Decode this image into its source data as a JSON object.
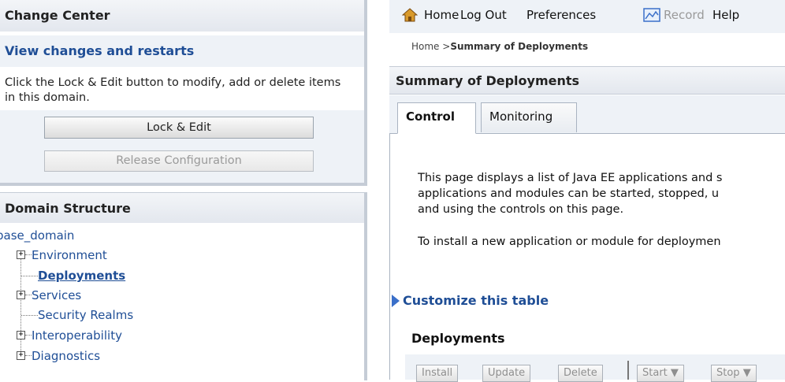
{
  "change_center": {
    "title": "Change Center",
    "subtitle": "View changes and restarts",
    "description": "Click the Lock & Edit button to modify, add or delete items in this domain.",
    "lock_edit_label": "Lock & Edit",
    "release_config_label": "Release Configuration"
  },
  "domain_structure": {
    "title": "Domain Structure",
    "root": "base_domain",
    "items": [
      {
        "label": "Environment",
        "expandable": true
      },
      {
        "label": "Deployments",
        "expandable": false,
        "selected": true
      },
      {
        "label": "Services",
        "expandable": true
      },
      {
        "label": "Security Realms",
        "expandable": false
      },
      {
        "label": "Interoperability",
        "expandable": true
      },
      {
        "label": "Diagnostics",
        "expandable": true
      }
    ]
  },
  "topnav": {
    "home": "Home",
    "logout": "Log Out",
    "preferences": "Preferences",
    "record": "Record",
    "help": "Help"
  },
  "breadcrumb": {
    "home": "Home >",
    "current": "Summary of Deployments"
  },
  "page_title": "Summary of Deployments",
  "tabs": [
    {
      "label": "Control",
      "active": true
    },
    {
      "label": "Monitoring",
      "active": false
    }
  ],
  "content": {
    "desc_line1": "This page displays a list of Java EE applications and s",
    "desc_line2": "applications and modules can be started, stopped, u",
    "desc_line3": "and using the controls on this page.",
    "install_hint": "To install a new application or module for deploymen",
    "customize_link": "Customize this table",
    "deployments_heading": "Deployments"
  },
  "table_toolbar": {
    "install": "Install",
    "update": "Update",
    "delete": "Delete",
    "start": "Start",
    "stop": "Stop"
  },
  "colors": {
    "link": "#1f4e96",
    "panel_bg": "#eef2f7",
    "disabled_text": "#8f8f8f"
  }
}
